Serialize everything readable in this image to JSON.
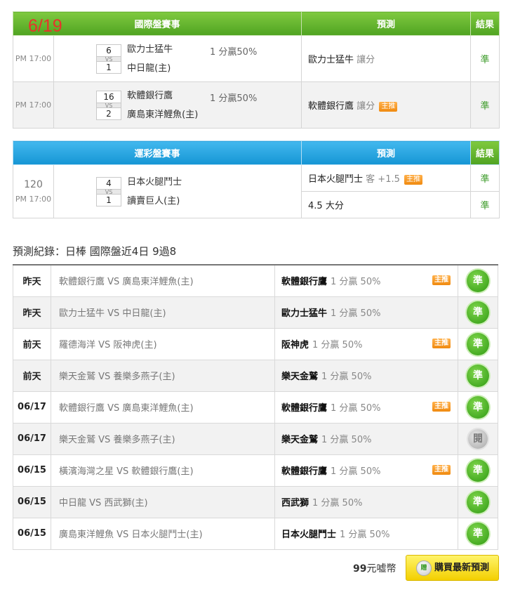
{
  "date_label": "6/19",
  "intl": {
    "header": {
      "event": "國際盤賽事",
      "predict": "預測",
      "result": "結果"
    },
    "rows": [
      {
        "time": "PM 17:00",
        "score_home_top": "6",
        "vs": "VS",
        "score_bottom": "1",
        "team_top": "歐力士猛牛",
        "team_bottom": "中日龍(主)",
        "odds": "1 分贏50%",
        "pred_team": "歐力士猛牛",
        "pred_type": "讓分",
        "tag": "",
        "result": "準"
      },
      {
        "time": "PM 17:00",
        "score_home_top": "16",
        "vs": "VS",
        "score_bottom": "2",
        "team_top": "軟體銀行鷹",
        "team_bottom": "廣島東洋鯉魚(主)",
        "odds": "1 分贏50%",
        "pred_team": "軟體銀行鷹",
        "pred_type": "讓分",
        "tag": "主推",
        "result": "準"
      }
    ]
  },
  "lottery": {
    "header": {
      "event": "運彩盤賽事",
      "predict": "預測",
      "result": "結果"
    },
    "num": "120",
    "time": "PM 17:00",
    "score_top": "4",
    "vs": "VS",
    "score_bottom": "1",
    "team_top": "日本火腿鬥士",
    "team_bottom": "讀賣巨人(主)",
    "pred1_team": "日本火腿鬥士",
    "pred1_type": "客 +1.5",
    "pred1_tag": "主推",
    "result1": "準",
    "pred2": "4.5 大分",
    "result2": "準"
  },
  "history": {
    "title": "預測紀錄：日棒 國際盤近4日 9過8",
    "rows": [
      {
        "date": "昨天",
        "match": "軟體銀行鷹 VS 廣島東洋鯉魚(主)",
        "pick": "軟體銀行鷹",
        "line": "1 分贏 50%",
        "tag": "主推",
        "result": "準",
        "status": "win"
      },
      {
        "date": "昨天",
        "match": "歐力士猛牛 VS 中日龍(主)",
        "pick": "歐力士猛牛",
        "line": "1 分贏 50%",
        "tag": "",
        "result": "準",
        "status": "win"
      },
      {
        "date": "前天",
        "match": "羅德海洋 VS 阪神虎(主)",
        "pick": "阪神虎",
        "line": "1 分贏 50%",
        "tag": "主推",
        "result": "準",
        "status": "win"
      },
      {
        "date": "前天",
        "match": "樂天金鷲 VS 養樂多燕子(主)",
        "pick": "樂天金鷲",
        "line": "1 分贏 50%",
        "tag": "",
        "result": "準",
        "status": "win"
      },
      {
        "date": "06/17",
        "match": "軟體銀行鷹 VS 廣島東洋鯉魚(主)",
        "pick": "軟體銀行鷹",
        "line": "1 分贏 50%",
        "tag": "主推",
        "result": "準",
        "status": "win"
      },
      {
        "date": "06/17",
        "match": "樂天金鷲 VS 養樂多燕子(主)",
        "pick": "樂天金鷲",
        "line": "1 分贏 50%",
        "tag": "",
        "result": "閱",
        "status": "push"
      },
      {
        "date": "06/15",
        "match": "橫濱海灣之星 VS 軟體銀行鷹(主)",
        "pick": "軟體銀行鷹",
        "line": "1 分贏 50%",
        "tag": "主推",
        "result": "準",
        "status": "win"
      },
      {
        "date": "06/15",
        "match": "中日龍 VS 西武獅(主)",
        "pick": "西武獅",
        "line": "1 分贏 50%",
        "tag": "",
        "result": "準",
        "status": "win"
      },
      {
        "date": "06/15",
        "match": "廣島東洋鯉魚 VS 日本火腿鬥士(主)",
        "pick": "日本火腿鬥士",
        "line": "1 分贏 50%",
        "tag": "",
        "result": "準",
        "status": "win"
      }
    ]
  },
  "purchase": {
    "price": "99",
    "unit": "元嘘幣",
    "button": "購買最新預測",
    "icon_text": "贈"
  },
  "colors": {
    "green_header": "#4fa321",
    "blue_header": "#1595d4",
    "win": "#3a9a26",
    "date_red": "#e6342b",
    "button_yellow": "#f3cf00"
  }
}
